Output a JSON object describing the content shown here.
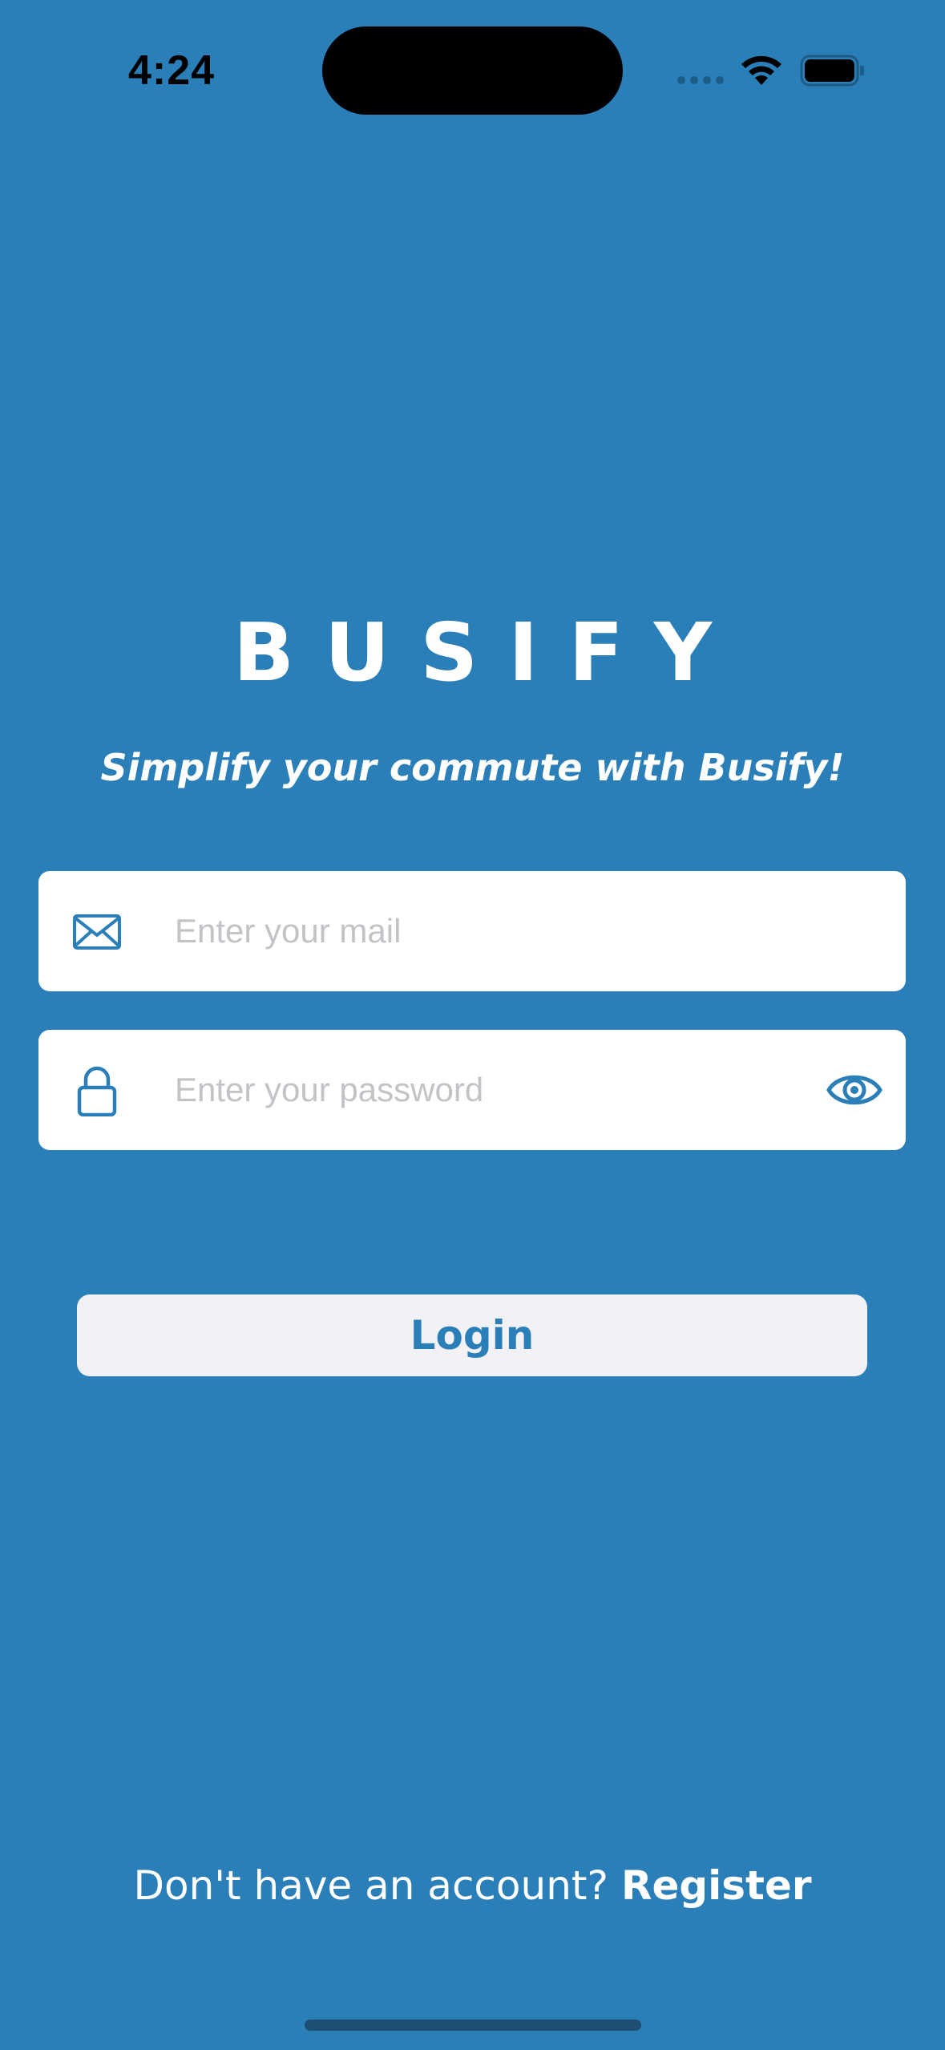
{
  "status_bar": {
    "time": "4:24"
  },
  "brand": {
    "title": "BUSIFY",
    "tagline": "Simplify your commute with Busify!"
  },
  "form": {
    "email": {
      "placeholder": "Enter your mail",
      "value": ""
    },
    "password": {
      "placeholder": "Enter your password",
      "value": ""
    },
    "login_label": "Login"
  },
  "footer": {
    "prompt": "Don't have an account? ",
    "register_label": "Register"
  },
  "icons": {
    "email": "envelope-icon",
    "password": "lock-icon",
    "toggle": "eye-icon"
  },
  "colors": {
    "background": "#2b7fb8",
    "accent": "#2b7fb8",
    "button_bg": "#f2f1f6"
  }
}
